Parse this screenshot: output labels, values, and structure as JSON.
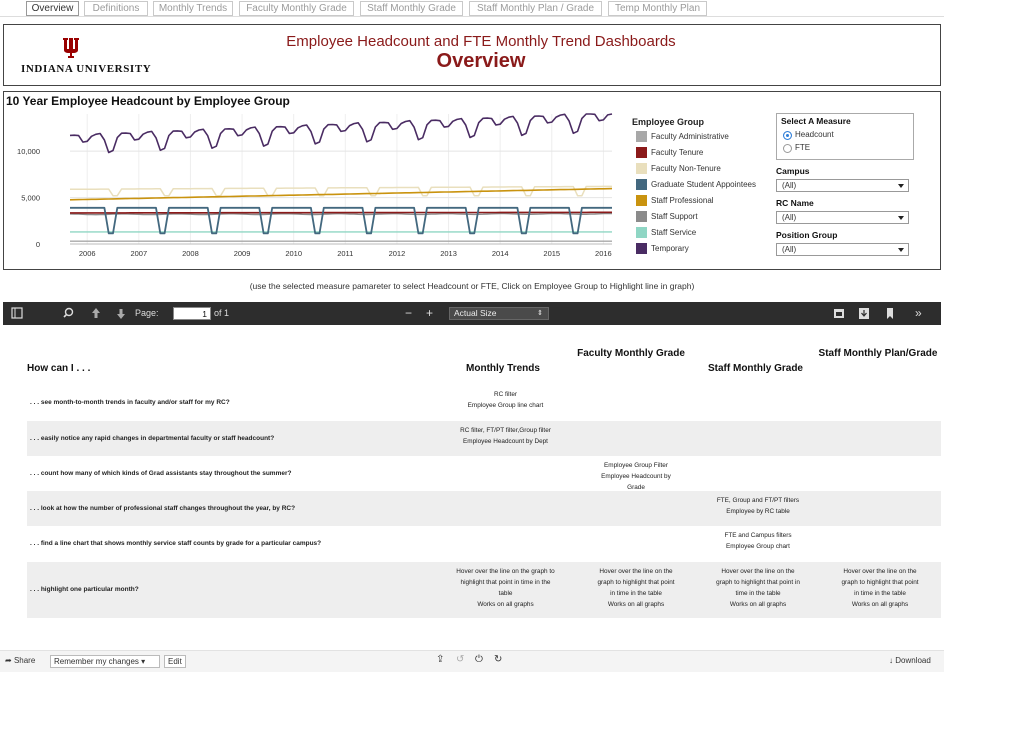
{
  "tabs": [
    "Overview",
    "Definitions",
    "Monthly Trends",
    "Faculty Monthly Grade",
    "Staff Monthly Grade",
    "Staff Monthly Plan / Grade",
    "Temp Monthly Plan"
  ],
  "header": {
    "university": "INDIANA UNIVERSITY",
    "title": "Employee Headcount and FTE  Monthly Trend Dashboards",
    "subtitle": "Overview"
  },
  "chart_panel": {
    "title": "10 Year Employee Headcount by Employee Group"
  },
  "chart_data": {
    "type": "line",
    "title": "10 Year Employee Headcount by Employee Group",
    "x_ticks": [
      "2006",
      "2007",
      "2008",
      "2009",
      "2010",
      "2011",
      "2012",
      "2013",
      "2014",
      "2015",
      "2016"
    ],
    "y_ticks": [
      0,
      5000,
      10000
    ],
    "ylim": [
      0,
      14000
    ],
    "x_range": [
      "2005-09",
      "2016-03"
    ],
    "grid": true,
    "legend_placement": "right",
    "series": [
      {
        "name": "Faculty Administrative",
        "color": "#a8a8a8",
        "approx_level": 300
      },
      {
        "name": "Faculty Tenure",
        "color": "#8b1a1a",
        "approx_level": 3200
      },
      {
        "name": "Faculty Non-Tenure",
        "color": "#e9dfbd",
        "approx_level": 5000
      },
      {
        "name": "Graduate Student Appointees",
        "color": "#43687f",
        "approx_level": 3500
      },
      {
        "name": "Staff Professional",
        "color": "#c9930f",
        "approx_level": 5500
      },
      {
        "name": "Staff Support",
        "color": "#8b8b8b",
        "approx_level": 3300
      },
      {
        "name": "Staff Service",
        "color": "#8fd6c4",
        "approx_level": 1300
      },
      {
        "name": "Temporary",
        "color": "#4a2c63",
        "approx_level": 11500
      }
    ]
  },
  "legend": {
    "title": "Employee Group",
    "items": [
      {
        "label": "Faculty Administrative",
        "color": "#a8a8a8"
      },
      {
        "label": "Faculty Tenure",
        "color": "#8b1a1a"
      },
      {
        "label": "Faculty Non-Tenure",
        "color": "#e9dfbd"
      },
      {
        "label": "Graduate Student Appointees",
        "color": "#43687f"
      },
      {
        "label": "Staff Professional",
        "color": "#c9930f"
      },
      {
        "label": "Staff Support",
        "color": "#8b8b8b"
      },
      {
        "label": "Staff Service",
        "color": "#8fd6c4"
      },
      {
        "label": "Temporary",
        "color": "#4a2c63"
      }
    ]
  },
  "controls": {
    "measure_title": "Select A Measure",
    "measure_options": [
      "Headcount",
      "FTE"
    ],
    "measure_selected": "Headcount",
    "campus_title": "Campus",
    "campus_value": "(All)",
    "rc_title": "RC Name",
    "rc_value": "(All)",
    "position_title": "Position Group",
    "position_value": "(All)"
  },
  "caption": "(use the selected measure pamareter to select Headcount or FTE, Click on Employee Group to Highlight line in graph)",
  "pdf_toolbar": {
    "page_label": "Page:",
    "page_value": "1",
    "page_of": "of 1",
    "minus": "−",
    "plus": "+",
    "zoom_value": "Actual Size"
  },
  "howto": {
    "question_header": "How can I . . .",
    "columns": [
      "Monthly Trends",
      "Faculty Monthly Grade",
      "Staff Monthly Grade",
      "Staff Monthly Plan/Grade"
    ],
    "rows": [
      {
        "q": ". . . see month-to-month trends in faculty and/or staff for my RC?",
        "cells": [
          "RC filter\nEmployee Group line chart",
          "",
          "",
          ""
        ]
      },
      {
        "q": ". . . easily notice any rapid changes in departmental faculty or staff headcount?",
        "cells": [
          "RC filter, FT/PT filter,Group filter\nEmployee Headcount by Dept",
          "",
          "",
          ""
        ]
      },
      {
        "q": ". . . count how many of which kinds of Grad assistants stay throughout the summer?",
        "cells": [
          "",
          "Employee Group Filter\nEmployee Headcount by\nGrade",
          "",
          ""
        ]
      },
      {
        "q": ". . . look at how the number of professional staff changes throughout the year, by RC?",
        "cells": [
          "",
          "",
          "FTE, Group and FT/PT filters\nEmployee by RC table",
          ""
        ]
      },
      {
        "q": ". . . find a line chart that shows monthly service staff counts by grade for a particular campus?",
        "cells": [
          "",
          "",
          "FTE and Campus filters\nEmployee Group chart",
          ""
        ]
      },
      {
        "q": ". . . highlight one particular month?",
        "cells": [
          "Hover over the line on the graph to\nhighlight that point in time in the\ntable\nWorks on all graphs",
          "Hover over the line on the\ngraph to highlight that point\nin time in the table\nWorks on all graphs",
          "Hover over the line on the\ngraph to highlight that point in\ntime in the table\nWorks on all graphs",
          "Hover over the line on the\ngraph to highlight that point\nin time in the table\nWorks on all graphs"
        ]
      }
    ]
  },
  "footer": {
    "share": "Share",
    "remember": "Remember my changes",
    "edit": "Edit",
    "download": "Download"
  }
}
